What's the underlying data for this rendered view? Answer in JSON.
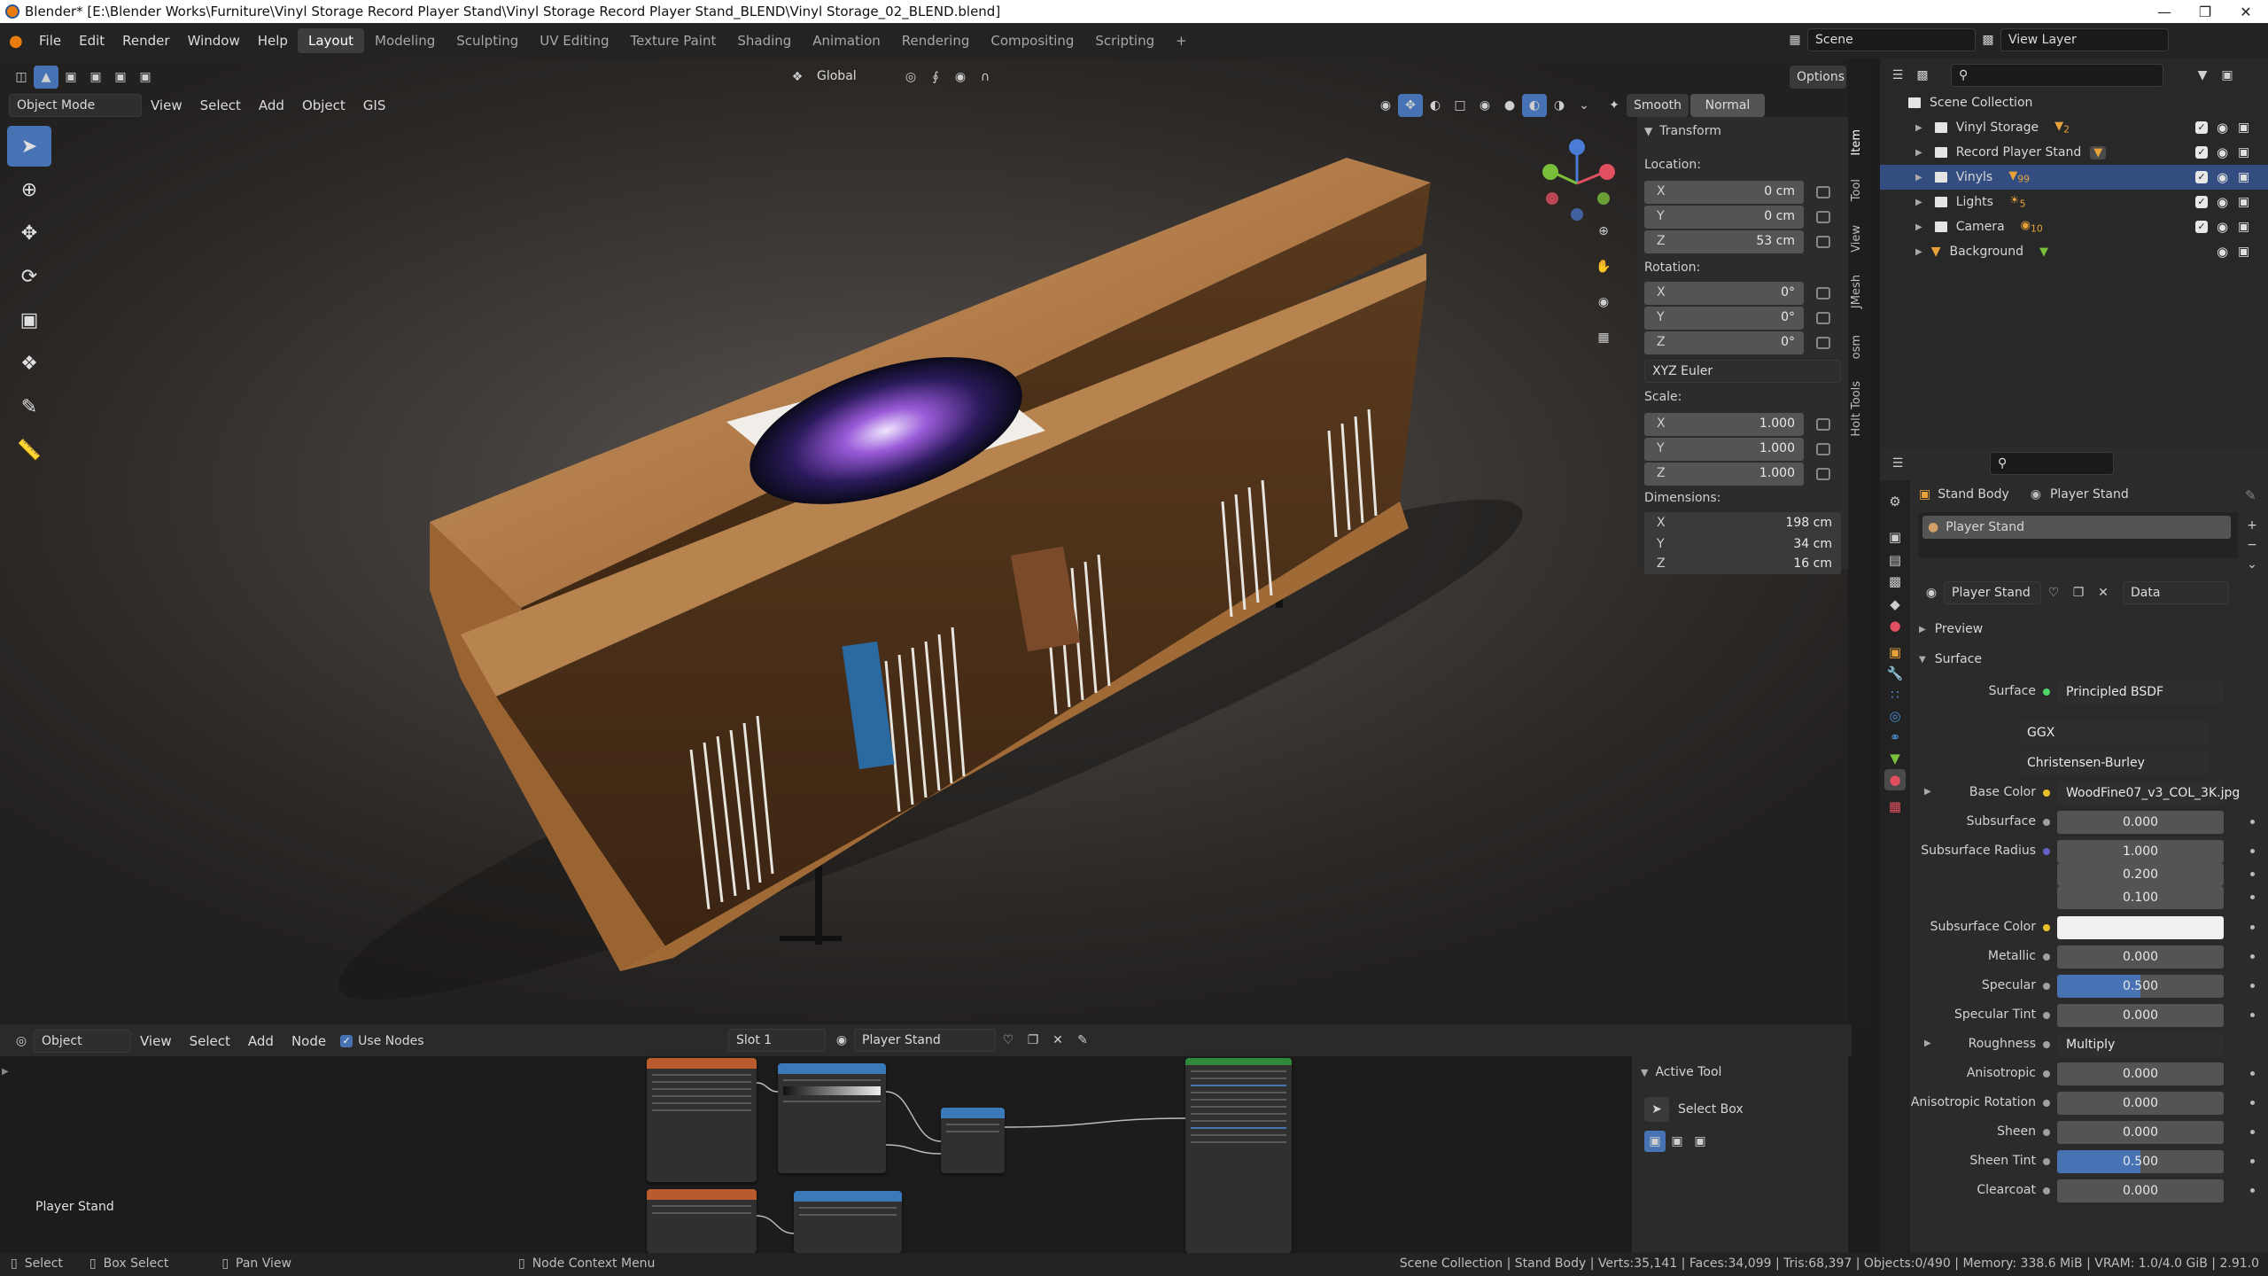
{
  "window": {
    "title": "Blender* [E:\\Blender Works\\Furniture\\Vinyl Storage Record Player Stand\\Vinyl Storage Record Player Stand_BLEND\\Vinyl Storage_02_BLEND.blend]"
  },
  "menu": [
    "File",
    "Edit",
    "Render",
    "Window",
    "Help"
  ],
  "workspaces": [
    "Layout",
    "Modeling",
    "Sculpting",
    "UV Editing",
    "Texture Paint",
    "Shading",
    "Animation",
    "Rendering",
    "Compositing",
    "Scripting"
  ],
  "workspace_active": "Layout",
  "header_right": {
    "scene": "Scene",
    "view_layer": "View Layer",
    "options": "Options"
  },
  "viewport": {
    "mode": "Object Mode",
    "menus": [
      "View",
      "Select",
      "Add",
      "Object",
      "GIS"
    ],
    "orientation": "Global",
    "shading": {
      "smooth": "Smooth",
      "normal": "Normal"
    }
  },
  "transform": {
    "title": "Transform",
    "location_label": "Location:",
    "location": {
      "x": "0 cm",
      "y": "0 cm",
      "z": "53 cm"
    },
    "rotation_label": "Rotation:",
    "rotation": {
      "x": "0°",
      "y": "0°",
      "z": "0°"
    },
    "rotation_mode": "XYZ Euler",
    "scale_label": "Scale:",
    "scale": {
      "x": "1.000",
      "y": "1.000",
      "z": "1.000"
    },
    "dimensions_label": "Dimensions:",
    "dimensions": {
      "x": "198 cm",
      "y": "34 cm",
      "z": "16 cm"
    },
    "axis": {
      "x": "X",
      "y": "Y",
      "z": "Z"
    }
  },
  "side_tabs": [
    "Item",
    "Tool",
    "View",
    "JMesh",
    "osm",
    "Holt Tools"
  ],
  "outliner": {
    "root": "Scene Collection",
    "items": [
      {
        "name": "Vinyl Storage",
        "badge": "2"
      },
      {
        "name": "Record Player Stand",
        "badge": ""
      },
      {
        "name": "Vinyls",
        "badge": "99"
      },
      {
        "name": "Lights",
        "badge": "5"
      },
      {
        "name": "Camera",
        "badge": "10"
      },
      {
        "name": "Background",
        "badge": ""
      }
    ]
  },
  "properties": {
    "breadcrumb_object": "Stand Body",
    "breadcrumb_material": "Player Stand",
    "slot_name": "Player Stand",
    "material_name": "Player Stand",
    "link": "Data",
    "preview": "Preview",
    "surface_section": "Surface",
    "surface_label": "Surface",
    "surface_value": "Principled BSDF",
    "distribution": "GGX",
    "subsurface_method": "Christensen-Burley",
    "fields": [
      {
        "label": "Base Color",
        "value": "WoodFine07_v3_COL_3K.jpg"
      },
      {
        "label": "Subsurface",
        "value": "0.000"
      },
      {
        "label": "Subsurface Radius",
        "value": "1.000"
      },
      {
        "label": "",
        "value": "0.200"
      },
      {
        "label": "",
        "value": "0.100"
      },
      {
        "label": "Subsurface Color",
        "value": ""
      },
      {
        "label": "Metallic",
        "value": "0.000"
      },
      {
        "label": "Specular",
        "value": "0.500"
      },
      {
        "label": "Specular Tint",
        "value": "0.000"
      },
      {
        "label": "Roughness",
        "value": "Multiply"
      },
      {
        "label": "Anisotropic",
        "value": "0.000"
      },
      {
        "label": "Anisotropic Rotation",
        "value": "0.000"
      },
      {
        "label": "Sheen",
        "value": "0.000"
      },
      {
        "label": "Sheen Tint",
        "value": "0.500"
      },
      {
        "label": "Clearcoat",
        "value": "0.000"
      }
    ]
  },
  "node_editor": {
    "type": "Object",
    "menus": [
      "View",
      "Select",
      "Add",
      "Node"
    ],
    "use_nodes": "Use Nodes",
    "slot": "Slot 1",
    "material": "Player Stand",
    "object_label": "Player Stand"
  },
  "active_tool": {
    "title": "Active Tool",
    "tool": "Select Box"
  },
  "statusbar": {
    "select": "Select",
    "box_select": "Box Select",
    "pan_view": "Pan View",
    "context_menu": "Node Context Menu",
    "stats": "Scene Collection | Stand Body | Verts:35,141 | Faces:34,099 | Tris:68,397 | Objects:0/490 | Memory: 338.6 MiB | VRAM: 1.0/4.0 GiB | 2.91.0"
  },
  "colors": {
    "accent": "#4772b3",
    "selection": "#334d80",
    "header": "#232323",
    "panel": "#2b2b2b"
  }
}
